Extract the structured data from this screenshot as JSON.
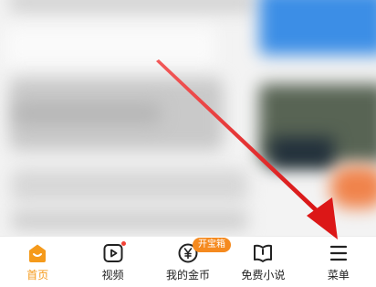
{
  "tabbar": {
    "items": [
      {
        "label": "首页",
        "icon": "home-icon",
        "active": true
      },
      {
        "label": "视频",
        "icon": "video-play-icon",
        "has_dot": true
      },
      {
        "label": "我的金币",
        "icon": "coin-icon",
        "badge": "开宝箱"
      },
      {
        "label": "免费小说",
        "icon": "book-icon"
      },
      {
        "label": "菜单",
        "icon": "menu-icon"
      }
    ]
  },
  "colors": {
    "accent": "#f59a1b",
    "badge": "#f58a1f",
    "notification_dot": "#f24236",
    "arrow": "#e31b1b",
    "inactive_text": "#222222"
  }
}
